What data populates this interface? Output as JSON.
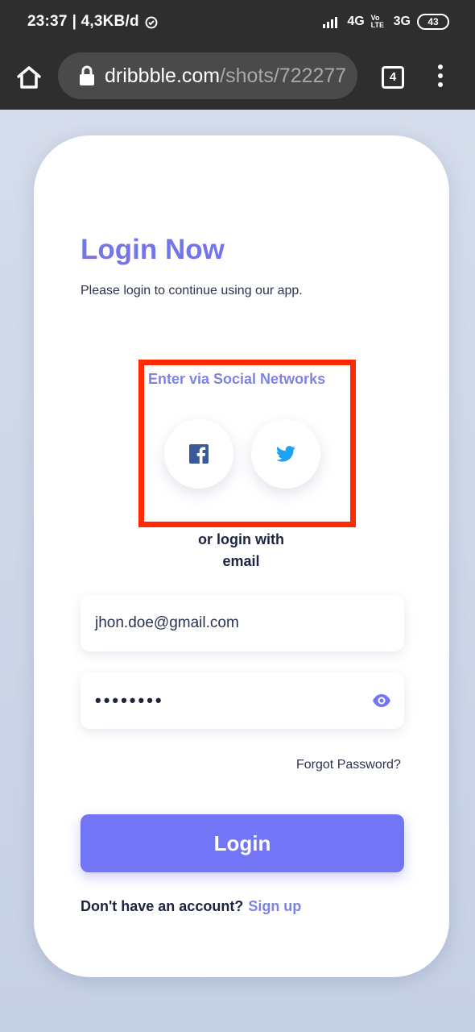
{
  "status_bar": {
    "time": "23:37",
    "speed": "| 4,3KB/d",
    "network_4g": "4G",
    "volte": "Vo LTE",
    "network_3g": "3G",
    "battery": "43"
  },
  "browser": {
    "url_domain": "dribbble.com",
    "url_path": "/shots/722277",
    "tab_count": "4"
  },
  "login": {
    "title": "Login Now",
    "subtitle": "Please login to continue using our app.",
    "social_title": "Enter via Social Networks",
    "or_text_line1": "or login with",
    "or_text_line2": "email",
    "email_value": "jhon.doe@gmail.com",
    "password_masked": "••••••••",
    "forgot": "Forgot Password?",
    "login_button": "Login",
    "no_account": "Don't have an account?",
    "signup": "Sign up"
  },
  "colors": {
    "accent": "#7276f6",
    "title": "#7476e8",
    "highlight": "#ff2a00",
    "facebook": "#3b5998",
    "twitter": "#1da1f2"
  }
}
